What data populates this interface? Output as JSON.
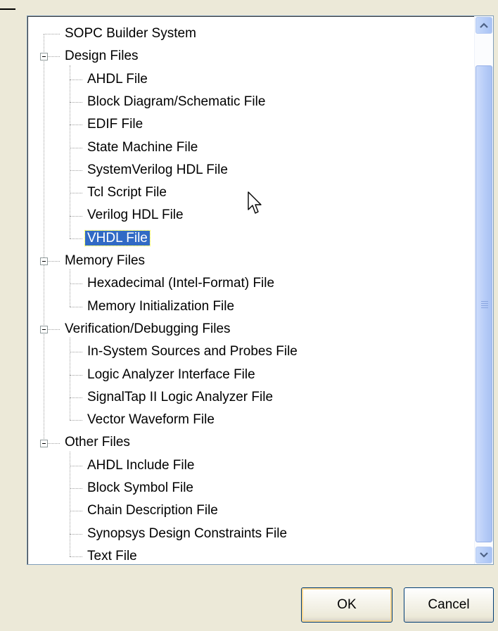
{
  "tree": [
    {
      "label": "SOPC Builder System",
      "level": 0,
      "group": false
    },
    {
      "label": "Design Files",
      "level": 0,
      "group": true
    },
    {
      "label": "AHDL File",
      "level": 1
    },
    {
      "label": "Block Diagram/Schematic File",
      "level": 1
    },
    {
      "label": "EDIF File",
      "level": 1
    },
    {
      "label": "State Machine File",
      "level": 1
    },
    {
      "label": "SystemVerilog HDL File",
      "level": 1
    },
    {
      "label": "Tcl Script File",
      "level": 1
    },
    {
      "label": "Verilog HDL File",
      "level": 1
    },
    {
      "label": "VHDL File",
      "level": 1,
      "selected": true
    },
    {
      "label": "Memory Files",
      "level": 0,
      "group": true
    },
    {
      "label": "Hexadecimal (Intel-Format) File",
      "level": 1
    },
    {
      "label": "Memory Initialization File",
      "level": 1
    },
    {
      "label": "Verification/Debugging Files",
      "level": 0,
      "group": true
    },
    {
      "label": "In-System Sources and Probes File",
      "level": 1
    },
    {
      "label": "Logic Analyzer Interface File",
      "level": 1
    },
    {
      "label": "SignalTap II Logic Analyzer File",
      "level": 1
    },
    {
      "label": "Vector Waveform File",
      "level": 1
    },
    {
      "label": "Other Files",
      "level": 0,
      "group": true
    },
    {
      "label": "AHDL Include File",
      "level": 1
    },
    {
      "label": "Block Symbol File",
      "level": 1
    },
    {
      "label": "Chain Description File",
      "level": 1
    },
    {
      "label": "Synopsys Design Constraints File",
      "level": 1
    },
    {
      "label": "Text File",
      "level": 1
    }
  ],
  "buttons": {
    "ok": "OK",
    "cancel": "Cancel"
  },
  "icons": {
    "expander": "minus-box-icon",
    "scroll_up": "chevron-up-icon",
    "scroll_down": "chevron-down-icon",
    "cursor": "mouse-pointer-icon"
  },
  "colors": {
    "selection": "#316ac5",
    "dialog_bg": "#ece9d8",
    "scrollbar": "#c6d9fa"
  }
}
